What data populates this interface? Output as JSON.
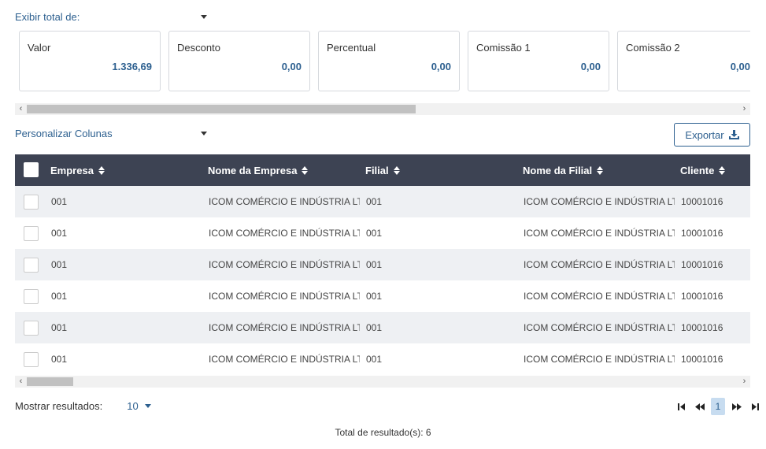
{
  "summary": {
    "select_label": "Exibir total de:",
    "cards": [
      {
        "title": "Valor",
        "value": "1.336,69"
      },
      {
        "title": "Desconto",
        "value": "0,00"
      },
      {
        "title": "Percentual",
        "value": "0,00"
      },
      {
        "title": "Comissão 1",
        "value": "0,00"
      },
      {
        "title": "Comissão 2",
        "value": "0,00"
      }
    ]
  },
  "columns_select_label": "Personalizar Colunas",
  "export_label": "Exportar",
  "table": {
    "headers": [
      "Empresa",
      "Nome da Empresa",
      "Filial",
      "Nome da Filial",
      "Cliente"
    ],
    "rows": [
      [
        "001",
        "ICOM COMÉRCIO E INDÚSTRIA LTD.",
        "001",
        "ICOM COMÉRCIO E INDÚSTRIA LTD.",
        "10001016"
      ],
      [
        "001",
        "ICOM COMÉRCIO E INDÚSTRIA LTD.",
        "001",
        "ICOM COMÉRCIO E INDÚSTRIA LTD.",
        "10001016"
      ],
      [
        "001",
        "ICOM COMÉRCIO E INDÚSTRIA LTD.",
        "001",
        "ICOM COMÉRCIO E INDÚSTRIA LTD.",
        "10001016"
      ],
      [
        "001",
        "ICOM COMÉRCIO E INDÚSTRIA LTD.",
        "001",
        "ICOM COMÉRCIO E INDÚSTRIA LTD.",
        "10001016"
      ],
      [
        "001",
        "ICOM COMÉRCIO E INDÚSTRIA LTD.",
        "001",
        "ICOM COMÉRCIO E INDÚSTRIA LTD.",
        "10001016"
      ],
      [
        "001",
        "ICOM COMÉRCIO E INDÚSTRIA LTD.",
        "001",
        "ICOM COMÉRCIO E INDÚSTRIA LTD.",
        "10001016"
      ]
    ]
  },
  "pagination": {
    "show_label": "Mostrar resultados:",
    "page_size": "10",
    "current_page": "1",
    "total_label": "Total de resultado(s): 6"
  },
  "colors": {
    "accent": "#2c5f8f",
    "header_bg": "#3d4353",
    "row_alt": "#eef0f3"
  },
  "icons": [
    "caret-down-icon",
    "sort-icon",
    "download-icon",
    "chevron-left-icon",
    "chevron-right-icon",
    "first-page-icon",
    "prev-page-icon",
    "next-page-icon",
    "last-page-icon"
  ]
}
